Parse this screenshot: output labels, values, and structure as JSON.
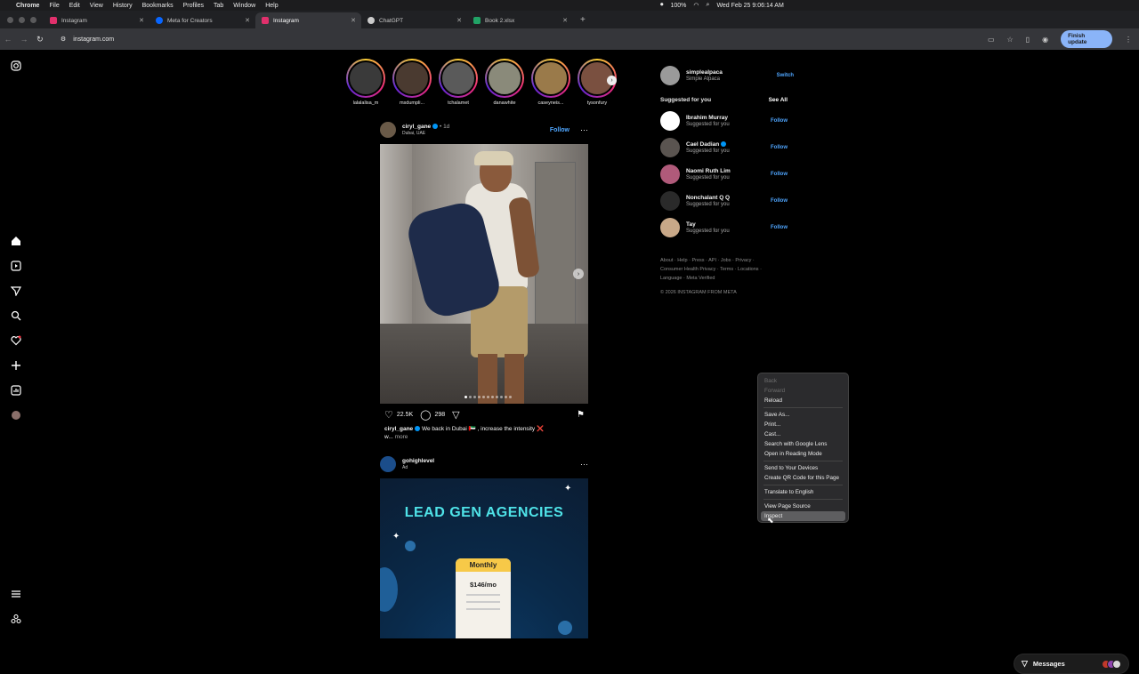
{
  "menubar": {
    "app": "Chrome",
    "items": [
      "File",
      "Edit",
      "View",
      "History",
      "Bookmarks",
      "Profiles",
      "Tab",
      "Window",
      "Help"
    ],
    "battery": "100%",
    "datetime": "Wed Feb 25 9:06:14 AM"
  },
  "tabs": [
    {
      "title": "Instagram",
      "favicon_color": "#e1306c"
    },
    {
      "title": "Meta for Creators",
      "favicon_color": "#0866ff"
    },
    {
      "title": "Instagram",
      "favicon_color": "#e1306c"
    },
    {
      "title": "ChatGPT",
      "favicon_color": "#cccccc"
    },
    {
      "title": "Book 2.xlsx",
      "favicon_color": "#21a366"
    }
  ],
  "toolbar": {
    "url": "instagram.com",
    "finish_update": "Finish update"
  },
  "nav_icons": [
    "instagram-logo-icon",
    "home-icon",
    "reels-icon",
    "messages-icon",
    "search-icon",
    "notifications-icon",
    "create-icon",
    "dashboard-icon",
    "profile-icon",
    "more-menu-icon",
    "meta-icon"
  ],
  "stories": [
    "lalalalisa_m",
    "msdumpli...",
    "tchalamet",
    "danawhite",
    "caseyneis...",
    "tysonfury"
  ],
  "post1": {
    "username": "ciryl_gane",
    "time": "• 1d",
    "location": "Dubai, UAE",
    "follow": "Follow",
    "likes": "22.5K",
    "comments": "298",
    "caption_user": "ciryl_gane",
    "caption_text": "We back in Dubai 🇦🇪 , increase the intensity ❌",
    "caption_more_prefix": "w...",
    "caption_more": "more"
  },
  "post2": {
    "username": "gohighlevel",
    "sub": "Ad",
    "ad_title": "LEAD GEN AGENCIES",
    "plan": "Monthly",
    "price": "$146/mo"
  },
  "account": {
    "username": "simplealpaca",
    "name": "Simple Alpaca",
    "switch": "Switch"
  },
  "suggested": {
    "heading": "Suggested for you",
    "see_all": "See All",
    "items": [
      {
        "name": "Ibrahim Murray",
        "sub": "Suggested for you",
        "follow": "Follow"
      },
      {
        "name": "Cael Dadian",
        "sub": "Suggested for you",
        "follow": "Follow"
      },
      {
        "name": "Naomi Ruth Lim",
        "sub": "Suggested for you",
        "follow": "Follow"
      },
      {
        "name": "Nonchalant Q Q",
        "sub": "Suggested for you",
        "follow": "Follow"
      },
      {
        "name": "Tay",
        "sub": "Suggested for you",
        "follow": "Follow"
      }
    ]
  },
  "footer": {
    "line1": "About · Help · Press · API · Jobs · Privacy ·",
    "line2": "Consumer Health Privacy · Terms · Locations ·",
    "line3": "Language · Meta Verified",
    "copyright": "© 2026 INSTAGRAM FROM META"
  },
  "context_menu": {
    "back": "Back",
    "forward": "Forward",
    "reload": "Reload",
    "save_as": "Save As...",
    "print": "Print...",
    "cast": "Cast...",
    "lens": "Search with Google Lens",
    "reading": "Open in Reading Mode",
    "send": "Send to Your Devices",
    "qr": "Create QR Code for this Page",
    "translate": "Translate to English",
    "source": "View Page Source",
    "inspect": "Inspect"
  },
  "messages": {
    "label": "Messages"
  },
  "colors": {
    "accent": "#4fa6ff",
    "background": "#000000",
    "ad_title": "#4fe3e8"
  }
}
